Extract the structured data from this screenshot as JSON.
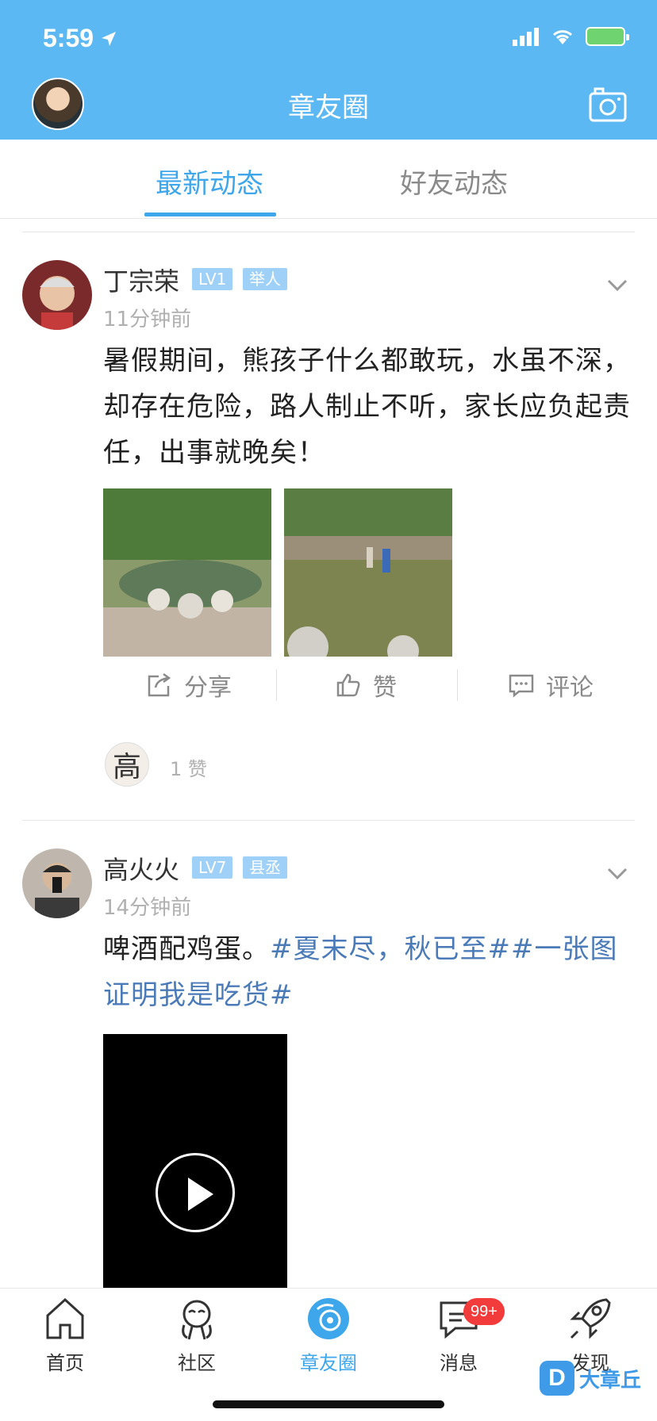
{
  "status_bar": {
    "time": "5:59"
  },
  "header": {
    "title": "章友圈"
  },
  "tabs": [
    {
      "label": "最新动态",
      "active": true
    },
    {
      "label": "好友动态",
      "active": false
    }
  ],
  "posts": [
    {
      "username": "丁宗荣",
      "level": "LV1",
      "title_badge": "举人",
      "time": "11分钟前",
      "text": "暑假期间，熊孩子什么都敢玩，水虽不深，却存在危险，路人制止不听，家长应负起责任，出事就晚矣！",
      "images": [
        "pond-photo-1",
        "pond-photo-2"
      ],
      "actions": {
        "share": "分享",
        "like": "赞",
        "comment": "评论"
      },
      "liker_glyph": "高",
      "like_count_text": "1 赞"
    },
    {
      "username": "高火火",
      "level": "LV7",
      "title_badge": "县丞",
      "time": "14分钟前",
      "text_plain": "啤酒配鸡蛋。",
      "text_hashtags": "#夏末尽，秋已至##一张图证明我是吃货#",
      "media": "video"
    }
  ],
  "bottom_nav": {
    "items": [
      {
        "label": "首页",
        "icon": "home-icon"
      },
      {
        "label": "社区",
        "icon": "community-icon"
      },
      {
        "label": "章友圈",
        "icon": "friends-circle-icon",
        "active": true
      },
      {
        "label": "消息",
        "icon": "message-icon",
        "badge": "99+"
      },
      {
        "label": "发现",
        "icon": "rocket-icon"
      }
    ]
  },
  "watermark": {
    "logo": "D",
    "text": "大章丘"
  },
  "colors": {
    "header": "#5cb8f2",
    "accent": "#3ea6ea",
    "hashtag": "#4a7bb8",
    "badge": "#9fd0f7",
    "notification": "#f23b3b"
  }
}
